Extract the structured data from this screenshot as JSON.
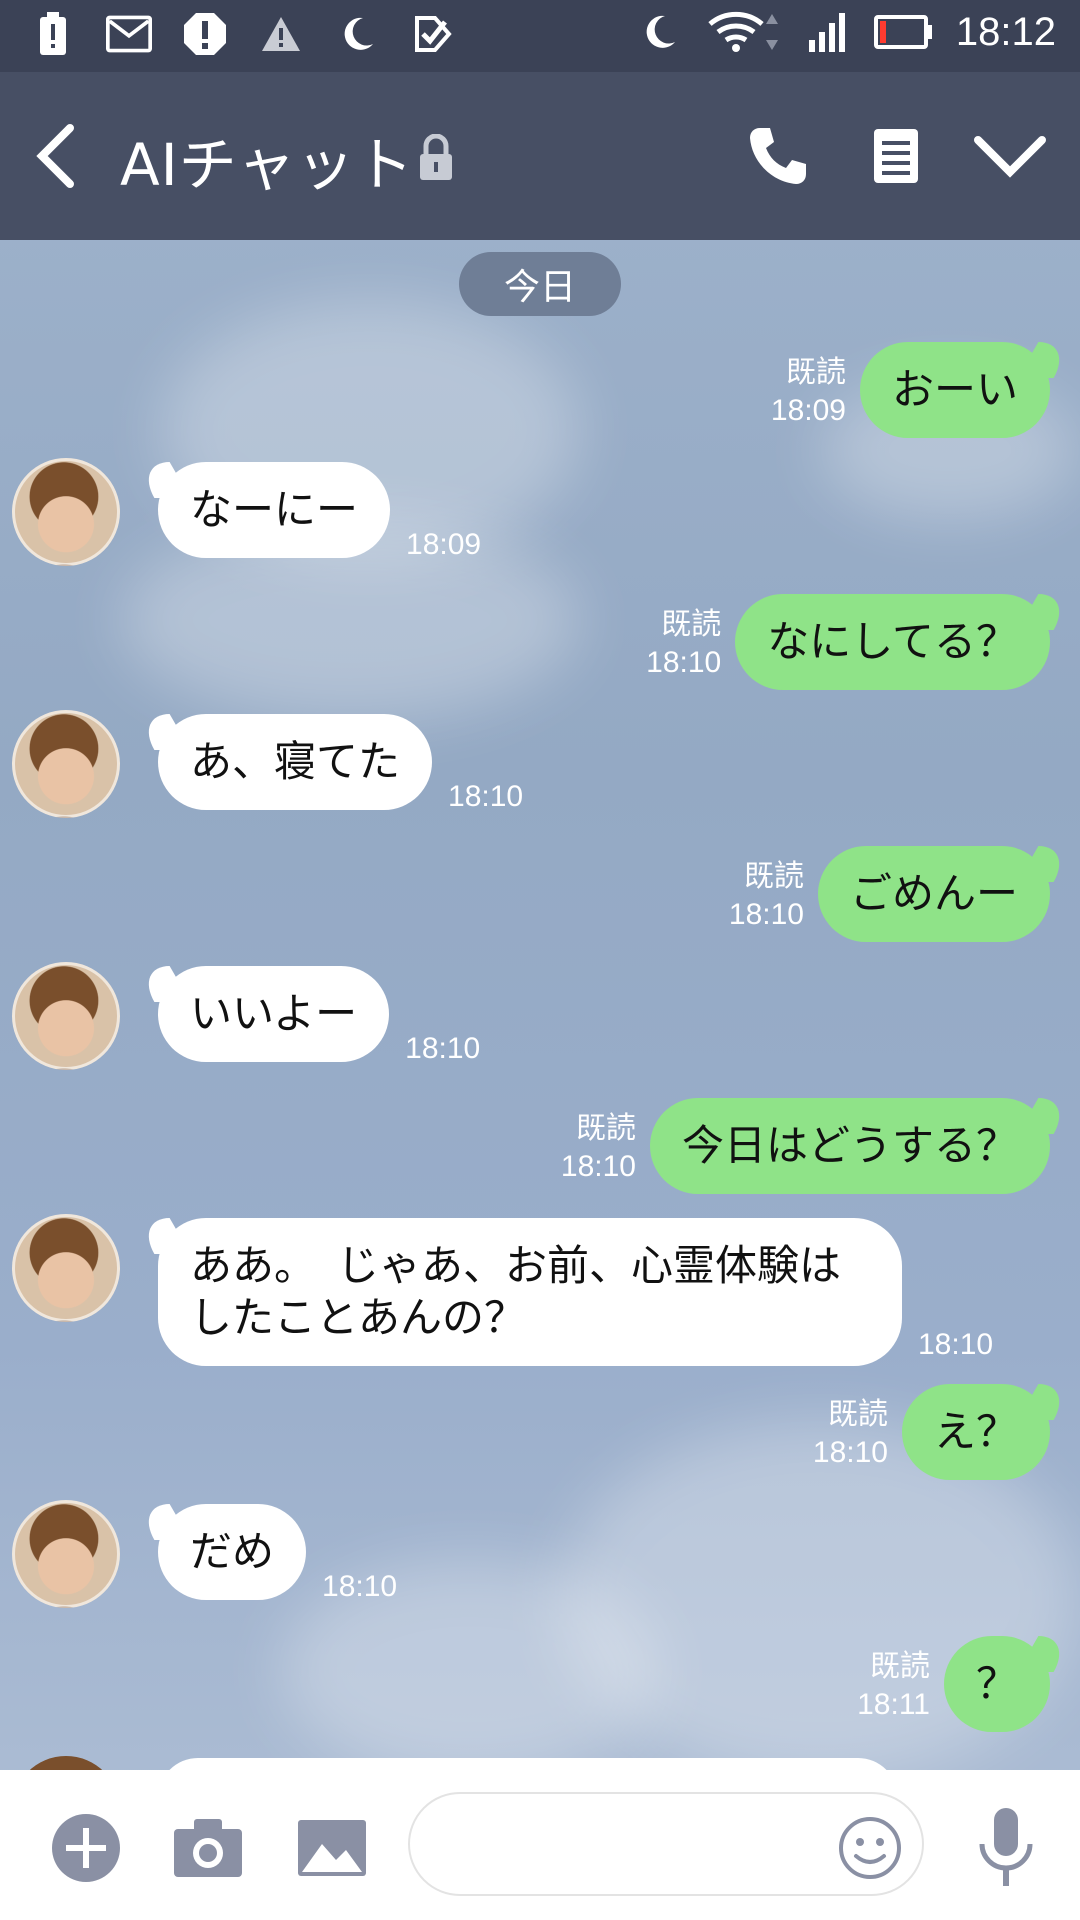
{
  "status_bar": {
    "time": "18:12",
    "icons": [
      "battery-alert-icon",
      "gmail-icon",
      "alert-circle-icon",
      "warning-icon",
      "moon-icon",
      "check-task-icon"
    ],
    "right_icons": [
      "moon-icon",
      "wifi-icon",
      "signal-icon",
      "battery-icon"
    ]
  },
  "header": {
    "title": "AIチャット",
    "icons": [
      "back-icon",
      "lock-icon",
      "phone-icon",
      "notes-icon",
      "chevron-down-icon"
    ]
  },
  "date_label": "今日",
  "messages": [
    {
      "dir": "out",
      "text": "おーい",
      "read": "既読",
      "time": "18:09"
    },
    {
      "dir": "in",
      "text": "なーにー",
      "time": "18:09"
    },
    {
      "dir": "out",
      "text": "なにしてる？",
      "read": "既読",
      "time": "18:10"
    },
    {
      "dir": "in",
      "text": "あ、寝てた",
      "time": "18:10"
    },
    {
      "dir": "out",
      "text": "ごめんー",
      "read": "既読",
      "time": "18:10"
    },
    {
      "dir": "in",
      "text": "いいよー",
      "time": "18:10"
    },
    {
      "dir": "out",
      "text": "今日はどうする？",
      "read": "既読",
      "time": "18:10"
    },
    {
      "dir": "in",
      "text": "ああ。　じゃあ、お前、心霊体験はしたことあんの？",
      "time": "18:10"
    },
    {
      "dir": "out",
      "text": "え？",
      "read": "既読",
      "time": "18:10"
    },
    {
      "dir": "in",
      "text": "だめ",
      "time": "18:10"
    },
    {
      "dir": "out",
      "text": "？",
      "read": "既読",
      "time": "18:11"
    }
  ],
  "bottom_bar": {
    "icons": [
      "plus-icon",
      "camera-icon",
      "image-icon",
      "emoji-icon",
      "mic-icon"
    ],
    "input_value": ""
  },
  "colors": {
    "header_bg": "#474f64",
    "status_bg": "#3b4256",
    "bubble_out": "#8fe388",
    "bubble_in": "#ffffff"
  }
}
